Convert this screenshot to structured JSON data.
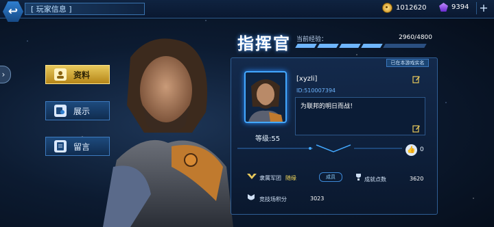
{
  "header": {
    "back_icon": "back-icon",
    "title": "[ 玩家信息 ]",
    "gold": "1012620",
    "gold_icon": "coin-icon",
    "gems": "9394",
    "gem_icon": "gem-icon",
    "plus_icon": "plus-icon"
  },
  "sidebar": {
    "items": [
      {
        "label": "资料",
        "icon": "profile-icon",
        "active": true
      },
      {
        "label": "展示",
        "icon": "showcase-icon",
        "active": false
      },
      {
        "label": "留言",
        "icon": "message-icon",
        "active": false
      }
    ]
  },
  "profile": {
    "title": "指挥官",
    "exp_label": "当前经验：",
    "exp_value": "2960/4800",
    "exp_progress": 0.62,
    "verified_badge": "已在本游戏实名",
    "name": "[xyzli]",
    "player_id": "ID:510007394",
    "level": "等级:55",
    "signature": "为联邦的明日而战！",
    "likes": "0",
    "legion_label": "隶属军团",
    "legion_name": "随缘",
    "legion_rank": "成员",
    "achievement_label": "成就点数",
    "achievement_value": "3620",
    "arena_label": "竞技场积分",
    "arena_value": "3023"
  },
  "colors": {
    "accent": "#43a8ff",
    "gold_button": "#e8c95c",
    "guild_name": "#f2d75a"
  }
}
